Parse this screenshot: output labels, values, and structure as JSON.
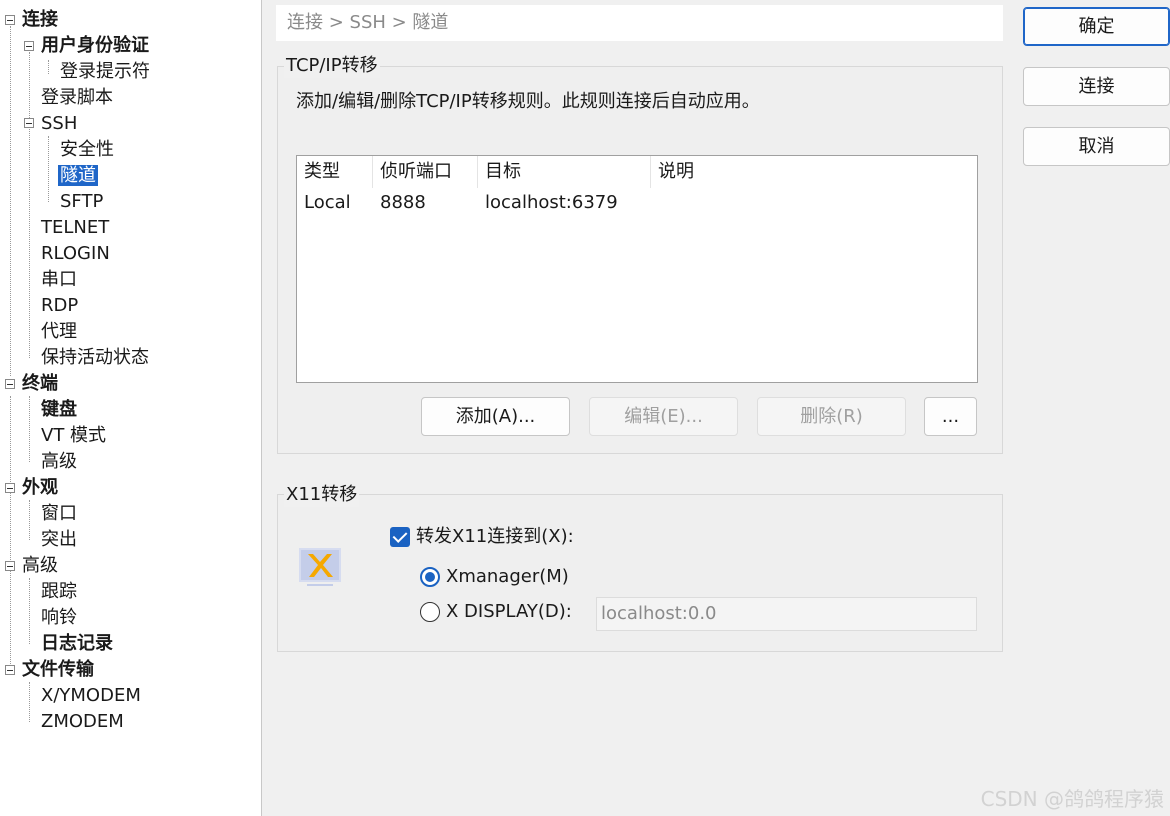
{
  "tree": [
    {
      "label": "连接",
      "bold": true,
      "indent": 0
    },
    {
      "label": "用户身份验证",
      "bold": true,
      "indent": 1
    },
    {
      "label": "登录提示符",
      "bold": false,
      "indent": 2
    },
    {
      "label": "登录脚本",
      "bold": false,
      "indent": 1
    },
    {
      "label": "SSH",
      "bold": false,
      "indent": 1
    },
    {
      "label": "安全性",
      "bold": false,
      "indent": 2
    },
    {
      "label": "隧道",
      "bold": false,
      "indent": 2,
      "selected": true
    },
    {
      "label": "SFTP",
      "bold": false,
      "indent": 2
    },
    {
      "label": "TELNET",
      "bold": false,
      "indent": 1
    },
    {
      "label": "RLOGIN",
      "bold": false,
      "indent": 1
    },
    {
      "label": "串口",
      "bold": false,
      "indent": 1
    },
    {
      "label": "RDP",
      "bold": false,
      "indent": 1
    },
    {
      "label": "代理",
      "bold": false,
      "indent": 1
    },
    {
      "label": "保持活动状态",
      "bold": false,
      "indent": 1
    },
    {
      "label": "终端",
      "bold": true,
      "indent": 0
    },
    {
      "label": "键盘",
      "bold": true,
      "indent": 1
    },
    {
      "label": "VT 模式",
      "bold": false,
      "indent": 1
    },
    {
      "label": "高级",
      "bold": false,
      "indent": 1
    },
    {
      "label": "外观",
      "bold": true,
      "indent": 0
    },
    {
      "label": "窗口",
      "bold": false,
      "indent": 1
    },
    {
      "label": "突出",
      "bold": false,
      "indent": 1
    },
    {
      "label": "高级",
      "bold": false,
      "indent": 0
    },
    {
      "label": "跟踪",
      "bold": false,
      "indent": 1
    },
    {
      "label": "响铃",
      "bold": false,
      "indent": 1
    },
    {
      "label": "日志记录",
      "bold": true,
      "indent": 1
    },
    {
      "label": "文件传输",
      "bold": true,
      "indent": 0
    },
    {
      "label": "X/YMODEM",
      "bold": false,
      "indent": 1
    },
    {
      "label": "ZMODEM",
      "bold": false,
      "indent": 1
    }
  ],
  "breadcrumb": "连接 > SSH > 隧道",
  "tcp": {
    "title": "TCP/IP转移",
    "description": "添加/编辑/删除TCP/IP转移规则。此规则连接后自动应用。",
    "columns": [
      "类型",
      "侦听端口",
      "目标",
      "说明"
    ],
    "rows": [
      {
        "type": "Local",
        "port": "8888",
        "target": "localhost:6379",
        "desc": ""
      }
    ],
    "buttons": {
      "add": "添加(A)...",
      "edit": "编辑(E)...",
      "delete": "删除(R)",
      "more": "..."
    }
  },
  "x11": {
    "title": "X11转移",
    "forward_label": "转发X11连接到(X):",
    "forward_checked": true,
    "xmanager_label": "Xmanager(M)",
    "display_label": "X DISPLAY(D):",
    "display_value": "localhost:0.0",
    "selected": "xmanager"
  },
  "dialog_buttons": {
    "ok": "确定",
    "connect": "连接",
    "cancel": "取消"
  },
  "watermark": "CSDN @鸽鸽程序猿",
  "colors": {
    "accent": "#1a62c2",
    "selection": "#1f66c8"
  }
}
